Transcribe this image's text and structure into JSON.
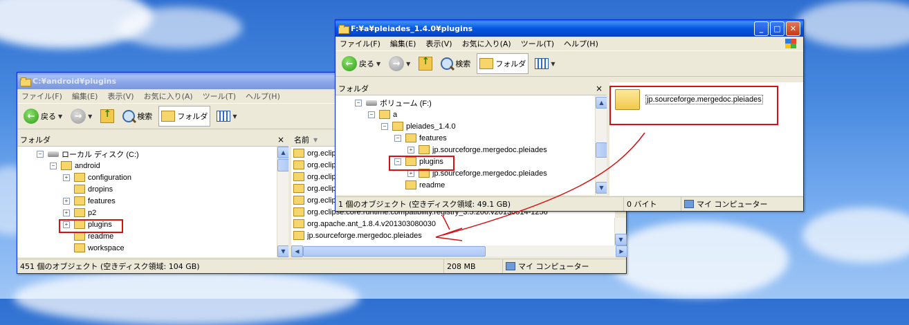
{
  "left_window": {
    "title": "C:¥android¥plugins",
    "menu": [
      "ファイル(F)",
      "編集(E)",
      "表示(V)",
      "お気に入り(A)",
      "ツール(T)",
      "ヘルプ(H)"
    ],
    "toolbar": {
      "back_label": "戻る",
      "search_label": "検索",
      "folders_label": "フォルダ"
    },
    "folder_pane_title": "フォルダ",
    "close_glyph": "×",
    "tree": [
      {
        "label": "ローカル ディスク (C:)",
        "type": "drive",
        "indent": 0,
        "toggle": "⊟"
      },
      {
        "label": "android",
        "type": "folder",
        "indent": 1,
        "toggle": "⊟"
      },
      {
        "label": "configuration",
        "type": "folder",
        "indent": 2,
        "toggle": "⊞"
      },
      {
        "label": "dropins",
        "type": "folder",
        "indent": 2,
        "toggle": ""
      },
      {
        "label": "features",
        "type": "folder",
        "indent": 2,
        "toggle": "⊞"
      },
      {
        "label": "p2",
        "type": "folder",
        "indent": 2,
        "toggle": "⊞"
      },
      {
        "label": "plugins",
        "type": "folder",
        "indent": 2,
        "toggle": "⊞"
      },
      {
        "label": "readme",
        "type": "folder",
        "indent": 2,
        "toggle": ""
      },
      {
        "label": "workspace",
        "type": "folder",
        "indent": 2,
        "toggle": ""
      }
    ],
    "list_header": "名前",
    "list": [
      "org.eclip",
      "org.eclip",
      "org.eclip",
      "org.eclip",
      "org.eclip",
      "org.eclipse.core.runtime.compatibility.registry_3.5.200.v20130514-1256",
      "org.apache.ant_1.8.4.v201303080030",
      "jp.sourceforge.mergedoc.pleiades"
    ],
    "status_objects": "451 個のオブジェクト (空きディスク領域: 104 GB)",
    "status_size": "208 MB",
    "status_location": "マイ コンピューター"
  },
  "right_window": {
    "title": "F:¥a¥pleiades_1.4.0¥plugins",
    "menu": [
      "ファイル(F)",
      "編集(E)",
      "表示(V)",
      "お気に入り(A)",
      "ツール(T)",
      "ヘルプ(H)"
    ],
    "toolbar": {
      "back_label": "戻る",
      "search_label": "検索",
      "folders_label": "フォルダ"
    },
    "folder_pane_title": "フォルダ",
    "close_glyph": "×",
    "tree": [
      {
        "label": "ボリューム (F:)",
        "type": "drive",
        "indent": 0,
        "toggle": "⊟"
      },
      {
        "label": "a",
        "type": "folder",
        "indent": 1,
        "toggle": "⊟"
      },
      {
        "label": "pleiades_1.4.0",
        "type": "folder",
        "indent": 2,
        "toggle": "⊟"
      },
      {
        "label": "features",
        "type": "folder",
        "indent": 3,
        "toggle": "⊟"
      },
      {
        "label": "jp.sourceforge.mergedoc.pleiades",
        "type": "folder",
        "indent": 4,
        "toggle": "⊞"
      },
      {
        "label": "plugins",
        "type": "folder",
        "indent": 3,
        "toggle": "⊟"
      },
      {
        "label": "jp.sourceforge.mergedoc.pleiades",
        "type": "folder",
        "indent": 4,
        "toggle": "⊞"
      },
      {
        "label": "readme",
        "type": "folder",
        "indent": 3,
        "toggle": ""
      }
    ],
    "content_item": "jp.sourceforge.mergedoc.pleiades",
    "status_objects": "1 個のオブジェクト (空きディスク領域: 49.1 GB)",
    "status_size": "0 バイト",
    "status_location": "マイ コンピューター"
  },
  "colors": {
    "highlight_red": "#d81010",
    "title_active": "#0755e0",
    "title_inactive": "#8aa5e8"
  }
}
